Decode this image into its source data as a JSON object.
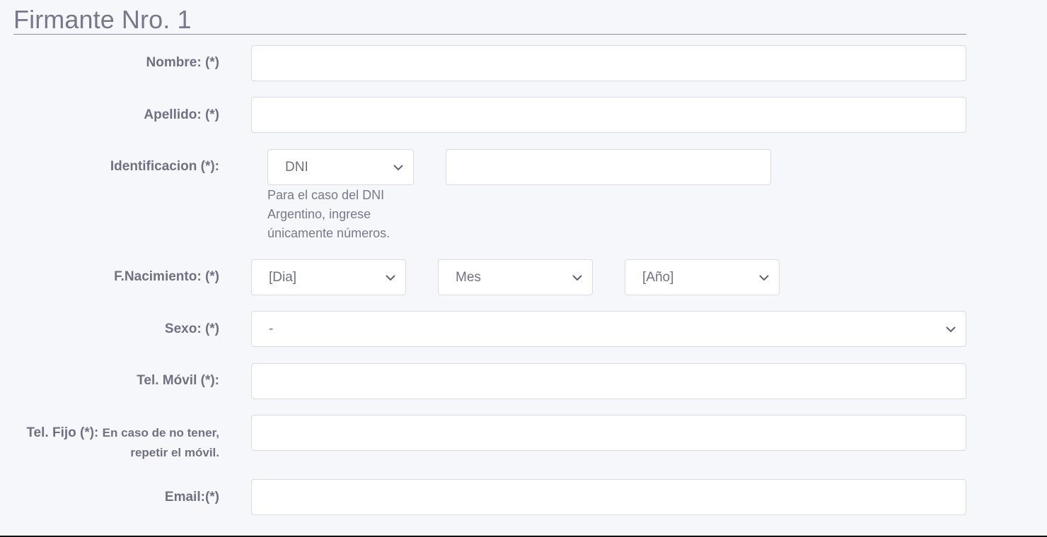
{
  "section": {
    "title": "Firmante Nro. 1"
  },
  "fields": {
    "nombre": {
      "label": "Nombre: (*)",
      "value": ""
    },
    "apellido": {
      "label": "Apellido: (*)",
      "value": ""
    },
    "identificacion": {
      "label": "Identificacion (*):",
      "type_value": "DNI",
      "number_value": "",
      "helper": "Para el caso del DNI Argentino, ingrese únicamente números."
    },
    "nacimiento": {
      "label": "F.Nacimiento: (*)",
      "day_value": "[Dia]",
      "month_value": "Mes",
      "year_value": "[Año]"
    },
    "sexo": {
      "label": "Sexo: (*)",
      "value": "-"
    },
    "movil": {
      "label": "Tel. Móvil (*):",
      "value": ""
    },
    "fijo": {
      "label_main": "Tel. Fijo (*): ",
      "label_note": "En caso de no tener, repetir el móvil.",
      "value": ""
    },
    "email": {
      "label": "Email:(*)",
      "value": ""
    }
  },
  "colors": {
    "background": "#f6f7fb",
    "text": "#6f7182",
    "border": "#d9dbe3"
  },
  "icons": {
    "select_arrow": "chevron-down-icon"
  }
}
